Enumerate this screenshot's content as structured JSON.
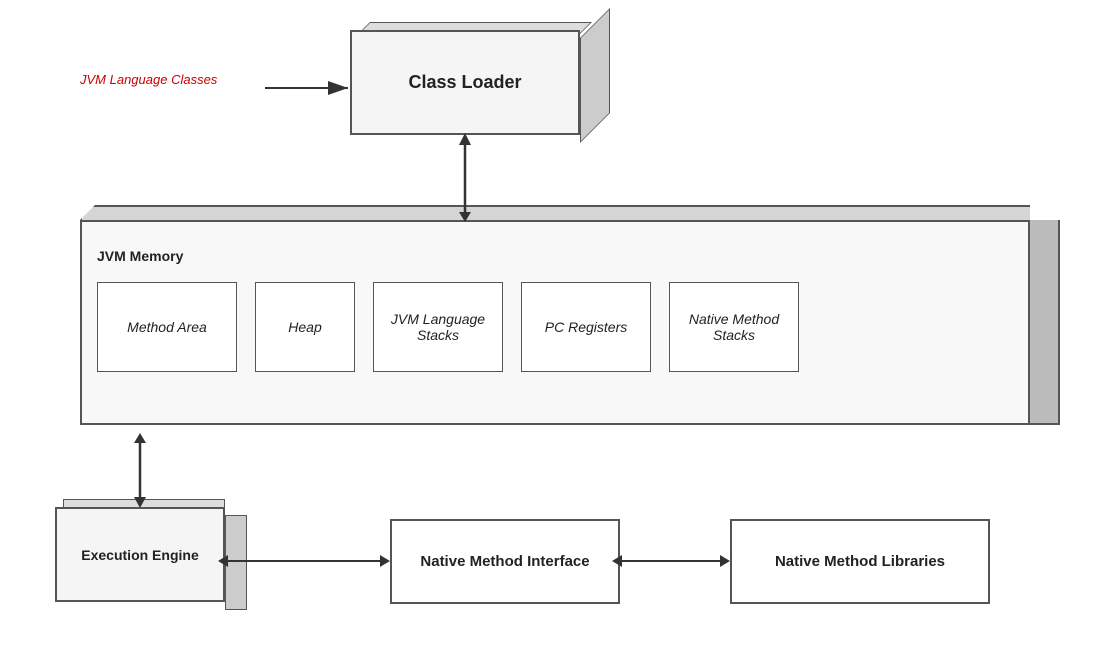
{
  "classLoader": {
    "label": "Class Loader"
  },
  "jvmLanguageClasses": {
    "label": "JVM Language Classes"
  },
  "jvmMemory": {
    "label": "JVM Memory",
    "boxes": [
      {
        "id": "method-area",
        "label": "Method Area"
      },
      {
        "id": "heap",
        "label": "Heap"
      },
      {
        "id": "jvm-stacks",
        "label": "JVM Language Stacks"
      },
      {
        "id": "pc-registers",
        "label": "PC Registers"
      },
      {
        "id": "native-stacks",
        "label": "Native Method Stacks"
      }
    ]
  },
  "executionEngine": {
    "label": "Execution Engine"
  },
  "nativeMethodInterface": {
    "label": "Native Method Interface"
  },
  "nativeMethodLibraries": {
    "label": "Native Method Libraries"
  }
}
